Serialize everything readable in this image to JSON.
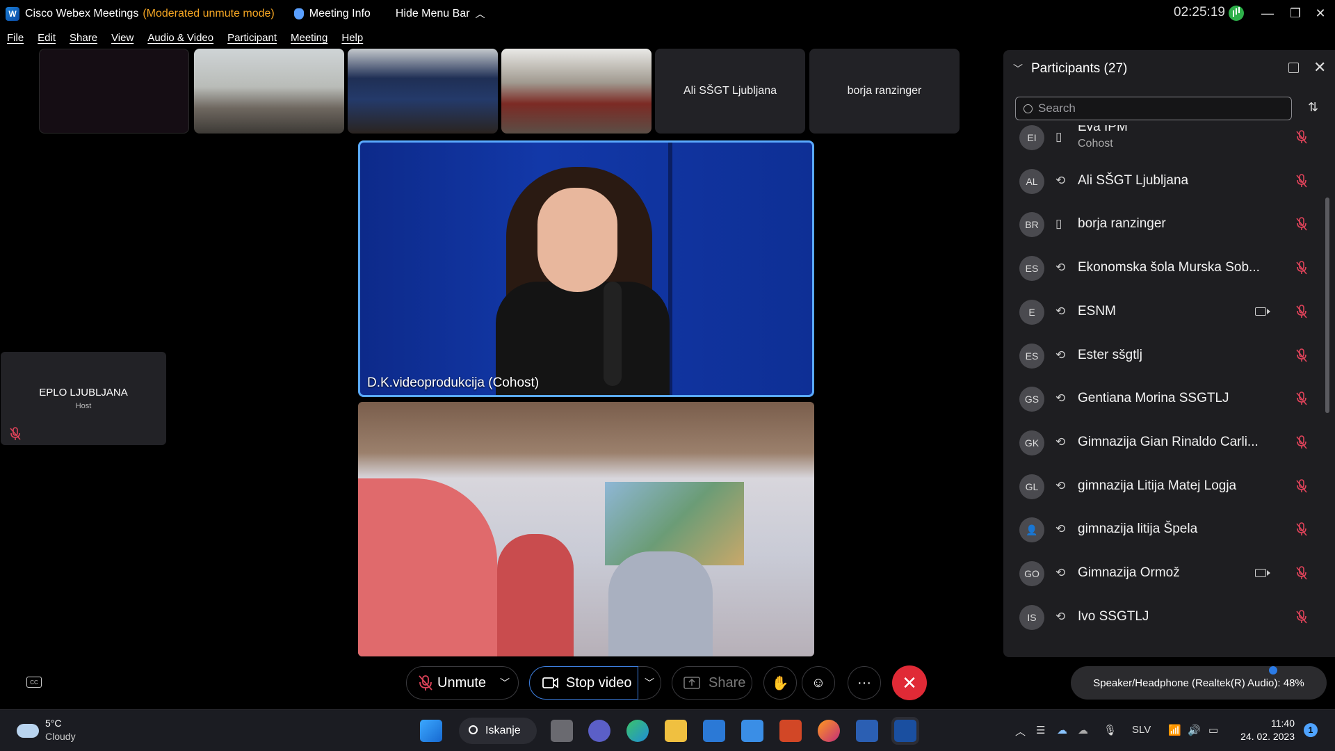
{
  "titlebar": {
    "app_name": "Cisco Webex Meetings",
    "mode": "(Moderated unmute mode)",
    "meeting_info": "Meeting Info",
    "hide_menu": "Hide Menu Bar",
    "clock": "02:25:19"
  },
  "menu": [
    "File",
    "Edit",
    "Share",
    "View",
    "Audio & Video",
    "Participant",
    "Meeting",
    "Help"
  ],
  "thumbnails": [
    {
      "label": ""
    },
    {
      "label": ""
    },
    {
      "label": ""
    },
    {
      "label": ""
    },
    {
      "label": "Ali SŠGT Ljubljana"
    },
    {
      "label": "borja ranzinger"
    }
  ],
  "main_video": {
    "label": "D.K.videoprodukcija (Cohost)"
  },
  "side_tile": {
    "name": "EPLO LJUBLJANA",
    "role": "Host"
  },
  "participants_panel": {
    "title": "Participants (27)",
    "search_placeholder": "Search",
    "participants": [
      {
        "initials": "EI",
        "name": "Eva IPM",
        "role": "Cohost",
        "device": "phone",
        "video": false,
        "muted": true
      },
      {
        "initials": "AL",
        "name": "Ali SŠGT Ljubljana",
        "device": "sync",
        "video": false
      },
      {
        "initials": "BR",
        "name": "borja ranzinger",
        "device": "phone",
        "video": false
      },
      {
        "initials": "ES",
        "name": "Ekonomska šola Murska Sob...",
        "device": "sync",
        "video": false
      },
      {
        "initials": "E",
        "name": "ESNM",
        "device": "sync",
        "video": true
      },
      {
        "initials": "ES",
        "name": "Ester sšgtlj",
        "device": "sync",
        "video": false
      },
      {
        "initials": "GS",
        "name": "Gentiana Morina SSGTLJ",
        "device": "sync",
        "video": false
      },
      {
        "initials": "GK",
        "name": "Gimnazija Gian Rinaldo Carli...",
        "device": "sync",
        "video": false
      },
      {
        "initials": "GL",
        "name": "gimnazija Litija Matej Logja",
        "device": "sync",
        "video": false
      },
      {
        "initials": "",
        "name": "gimnazija litija Špela",
        "device": "sync",
        "video": false
      },
      {
        "initials": "GO",
        "name": "Gimnazija Ormož",
        "device": "sync",
        "video": true
      },
      {
        "initials": "IS",
        "name": "Ivo SSGTLJ",
        "device": "sync",
        "video": false
      }
    ]
  },
  "controls": {
    "unmute": "Unmute",
    "stop_video": "Stop video",
    "share": "Share",
    "more": "···",
    "tooltip": "Speaker/Headphone (Realtek(R) Audio): 48%"
  },
  "taskbar": {
    "temp": "5°C",
    "weather": "Cloudy",
    "search": "Iskanje",
    "lang": "SLV",
    "time": "11:40",
    "date": "24. 02. 2023",
    "notifications": "1"
  },
  "colors": {
    "accent": "#3d7fe0",
    "end_call": "#e02a36",
    "mode_text": "#f5a623"
  }
}
